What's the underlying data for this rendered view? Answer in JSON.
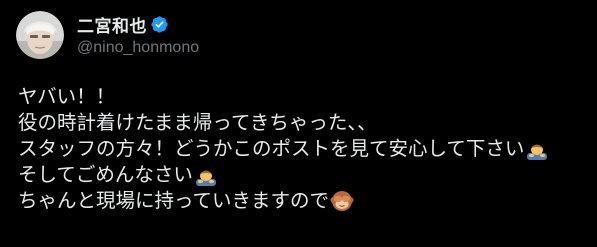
{
  "author": {
    "display_name": "二宮和也",
    "handle": "@nino_honmono",
    "verified_icon": "verified-badge-icon",
    "badge_color": "#1d9bf0"
  },
  "tweet": {
    "lines": [
      {
        "text": "ヤバい！！",
        "emoji": null
      },
      {
        "text": "役の時計着けたまま帰ってきちゃった、、",
        "emoji": null
      },
      {
        "text": "スタッフの方々！どうかこのポストを見て安心して下さい",
        "emoji": "person-bowing-icon"
      },
      {
        "text": "そしてごめんなさい",
        "emoji": "person-bowing-icon"
      },
      {
        "text": "ちゃんと現場に持っていきますので",
        "emoji": "see-no-evil-monkey-icon"
      }
    ]
  },
  "colors": {
    "background": "#000000",
    "text": "#e7e9ea",
    "secondary_text": "#71767b"
  }
}
